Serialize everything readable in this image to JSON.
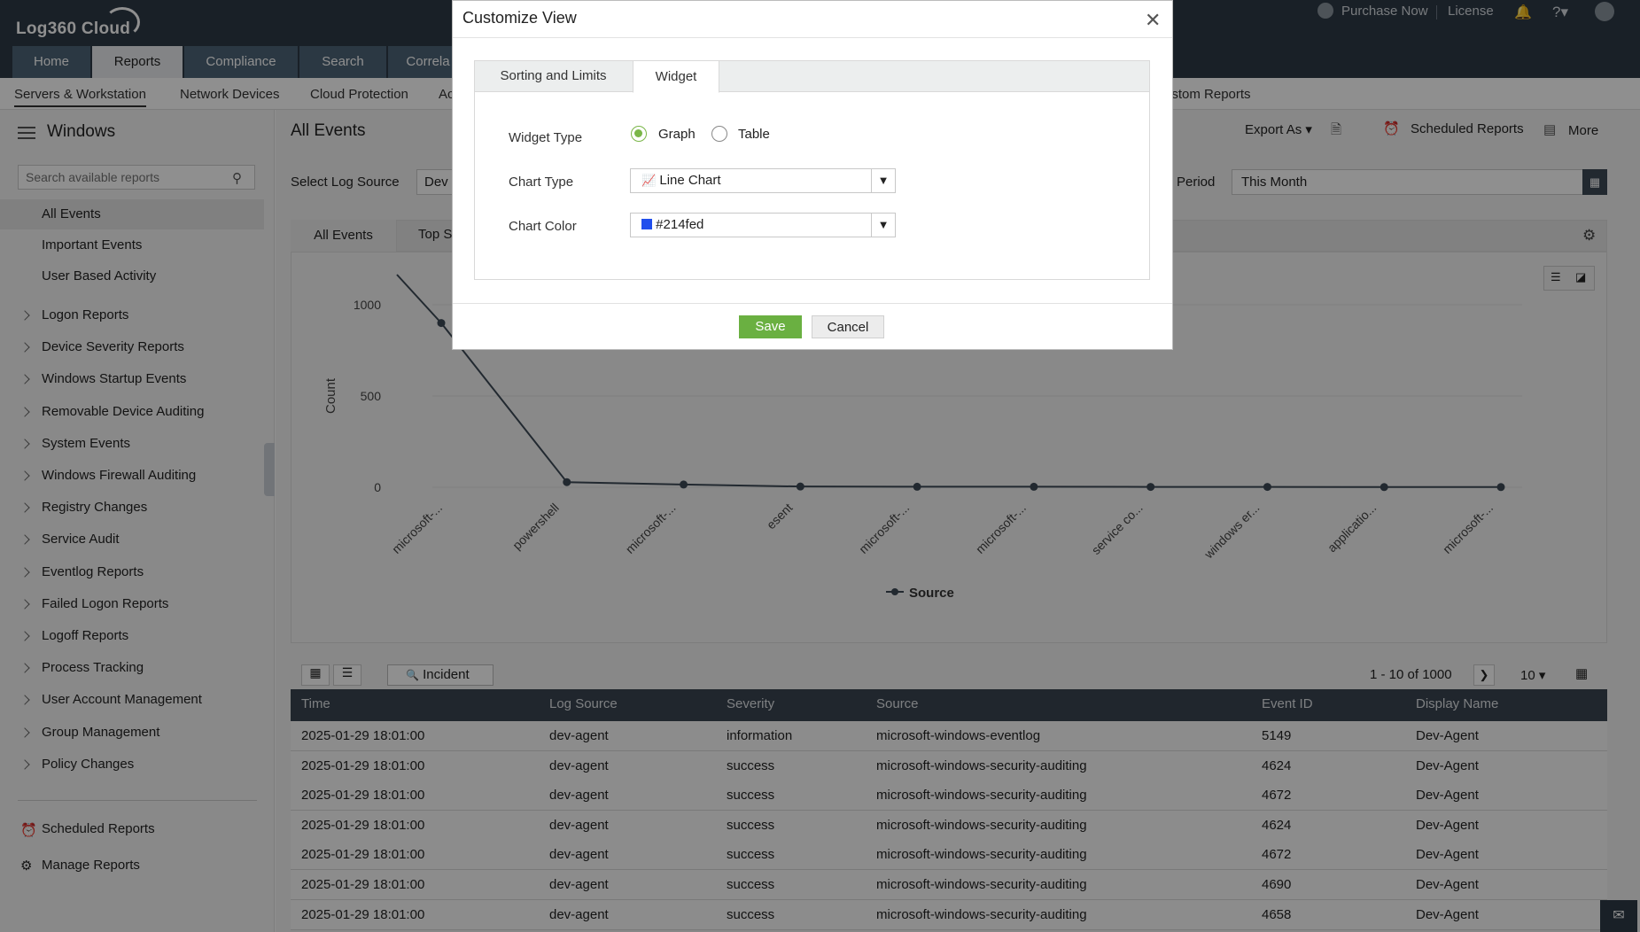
{
  "app": {
    "logo_text": "Log360 Cloud",
    "purchase": "Purchase Now",
    "license": "License"
  },
  "nav_tabs": [
    "Home",
    "Reports",
    "Compliance",
    "Search",
    "Correla"
  ],
  "sub_nav": [
    "Servers & Workstation",
    "Network Devices",
    "Cloud Protection",
    "Ac",
    "ustom Reports"
  ],
  "sidebar": {
    "title": "Windows",
    "search_placeholder": "Search available reports",
    "top_items": [
      "All Events",
      "Important Events",
      "User Based Activity"
    ],
    "groups": [
      "Logon Reports",
      "Device Severity Reports",
      "Windows Startup Events",
      "Removable Device Auditing",
      "System Events",
      "Windows Firewall Auditing",
      "Registry Changes",
      "Service Audit",
      "Eventlog Reports",
      "Failed Logon Reports",
      "Logoff Reports",
      "Process Tracking",
      "User Account Management",
      "Group Management",
      "Policy Changes"
    ],
    "footer": [
      "Scheduled Reports",
      "Manage Reports"
    ]
  },
  "main": {
    "title": "All Events",
    "export": "Export As",
    "scheduled": "Scheduled Reports",
    "more": "More",
    "log_source_label": "Select Log Source",
    "log_source_value": "Dev",
    "period_label": "Period",
    "period_value": "This Month",
    "tabs": [
      "All Events",
      "Top S"
    ]
  },
  "chart_data": {
    "type": "line",
    "categories": [
      "microsoft-...",
      "powershell",
      "microsoft-...",
      "esent",
      "microsoft-...",
      "microsoft-...",
      "service co...",
      "windows er...",
      "applicatio...",
      "microsoft-..."
    ],
    "series": [
      {
        "name": "Source",
        "values": [
          900,
          28,
          15,
          4,
          3,
          3,
          2,
          2,
          1,
          1
        ]
      }
    ],
    "ylabel": "Count",
    "yticks": [
      0,
      500,
      1000
    ],
    "ylim": [
      0,
      1000
    ],
    "legend": "bottom",
    "color": "#3d4a57"
  },
  "table": {
    "toolbar_incident": "Incident",
    "pagination": "1 - 10 of 1000",
    "page_size": "10",
    "columns": [
      "Time",
      "Log Source",
      "Severity",
      "Source",
      "Event ID",
      "Display Name"
    ],
    "rows": [
      [
        "2025-01-29 18:01:00",
        "dev-agent",
        "information",
        "microsoft-windows-eventlog",
        "5149",
        "Dev-Agent"
      ],
      [
        "2025-01-29 18:01:00",
        "dev-agent",
        "success",
        "microsoft-windows-security-auditing",
        "4624",
        "Dev-Agent"
      ],
      [
        "2025-01-29 18:01:00",
        "dev-agent",
        "success",
        "microsoft-windows-security-auditing",
        "4672",
        "Dev-Agent"
      ],
      [
        "2025-01-29 18:01:00",
        "dev-agent",
        "success",
        "microsoft-windows-security-auditing",
        "4624",
        "Dev-Agent"
      ],
      [
        "2025-01-29 18:01:00",
        "dev-agent",
        "success",
        "microsoft-windows-security-auditing",
        "4672",
        "Dev-Agent"
      ],
      [
        "2025-01-29 18:01:00",
        "dev-agent",
        "success",
        "microsoft-windows-security-auditing",
        "4690",
        "Dev-Agent"
      ],
      [
        "2025-01-29 18:01:00",
        "dev-agent",
        "success",
        "microsoft-windows-security-auditing",
        "4658",
        "Dev-Agent"
      ]
    ]
  },
  "dialog": {
    "title": "Customize View",
    "tabs": [
      "Sorting and Limits",
      "Widget"
    ],
    "widget_type_label": "Widget Type",
    "option_graph": "Graph",
    "option_table": "Table",
    "chart_type_label": "Chart Type",
    "chart_type_value": "Line Chart",
    "chart_color_label": "Chart Color",
    "chart_color_value": "#214fed",
    "save": "Save",
    "cancel": "Cancel"
  }
}
